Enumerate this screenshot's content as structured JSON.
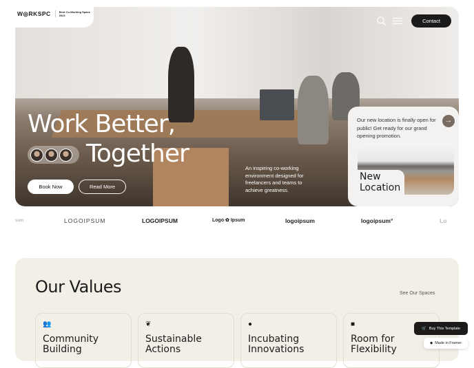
{
  "header": {
    "brand": "W◎RKSPC",
    "award": "Best Co-Working Space 2023",
    "contact": "Contact"
  },
  "hero": {
    "line1": "Work Better,",
    "line2": "Together",
    "book": "Book Now",
    "read": "Read More",
    "description": "An inspiring co-working environment designed for freelancers and teams to achieve greatness."
  },
  "promo": {
    "text": "Our new location is finally open for public! Get ready for our grand opening promotion.",
    "title": "New Location",
    "arrow": "→"
  },
  "logos": [
    "sum",
    "LOGOIPSUM",
    "LOGOIPSUM",
    "Logo ✿ Ipsum",
    "logoipsum",
    "logoipsum°",
    "Lo"
  ],
  "values": {
    "title": "Our Values",
    "see_all": "See Our Spaces",
    "cards": [
      {
        "icon": "users-icon",
        "title": "Community Building"
      },
      {
        "icon": "leaf-icon",
        "title": "Sustainable Actions"
      },
      {
        "icon": "lightbulb-icon",
        "title": "Incubating Innovations"
      },
      {
        "icon": "share-icon",
        "title": "Room for Flexibility"
      }
    ]
  },
  "badges": {
    "buy": "Buy This Template",
    "framer": "Made in Framer"
  }
}
